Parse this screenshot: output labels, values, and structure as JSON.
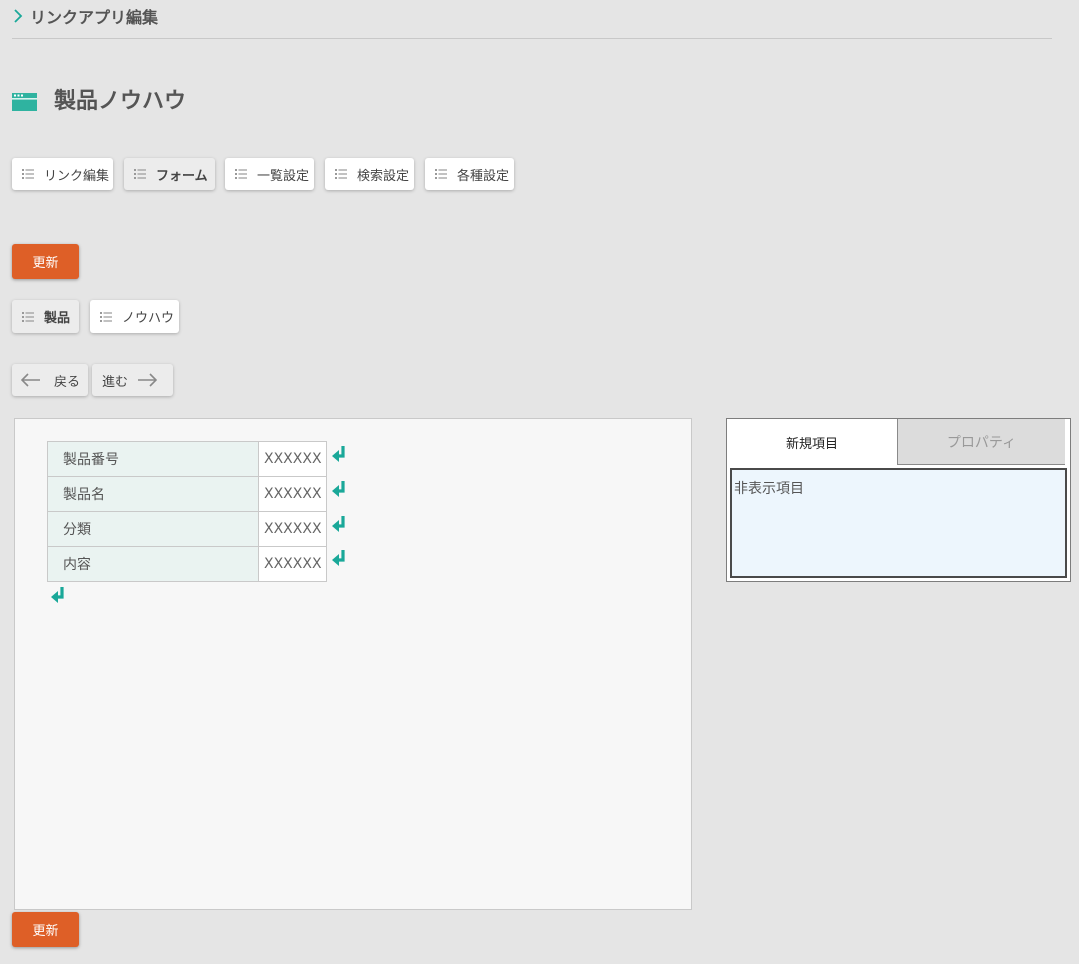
{
  "breadcrumb": {
    "label": "リンクアプリ編集"
  },
  "page": {
    "title": "製品ノウハウ"
  },
  "tabs": [
    {
      "label": "リンク編集",
      "active": false
    },
    {
      "label": "フォーム",
      "active": true
    },
    {
      "label": "一覧設定",
      "active": false
    },
    {
      "label": "検索設定",
      "active": false
    },
    {
      "label": "各種設定",
      "active": false
    }
  ],
  "update_label": "更新",
  "subtabs": [
    {
      "label": "製品",
      "active": true
    },
    {
      "label": "ノウハウ",
      "active": false
    }
  ],
  "nav": {
    "back_label": "戻る",
    "forward_label": "進む"
  },
  "form": {
    "rows": [
      {
        "label": "製品番号",
        "value": "XXXXXX"
      },
      {
        "label": "製品名",
        "value": "XXXXXX"
      },
      {
        "label": "分類",
        "value": "XXXXXX"
      },
      {
        "label": "内容",
        "value": "XXXXXX"
      }
    ]
  },
  "panel": {
    "tab_new_label": "新規項目",
    "tab_props_label": "プロパティ",
    "hidden_items_label": "非表示項目"
  },
  "colors": {
    "accent": "#de5f27",
    "teal": "#1aa899",
    "icon": "#2fb3a0"
  }
}
